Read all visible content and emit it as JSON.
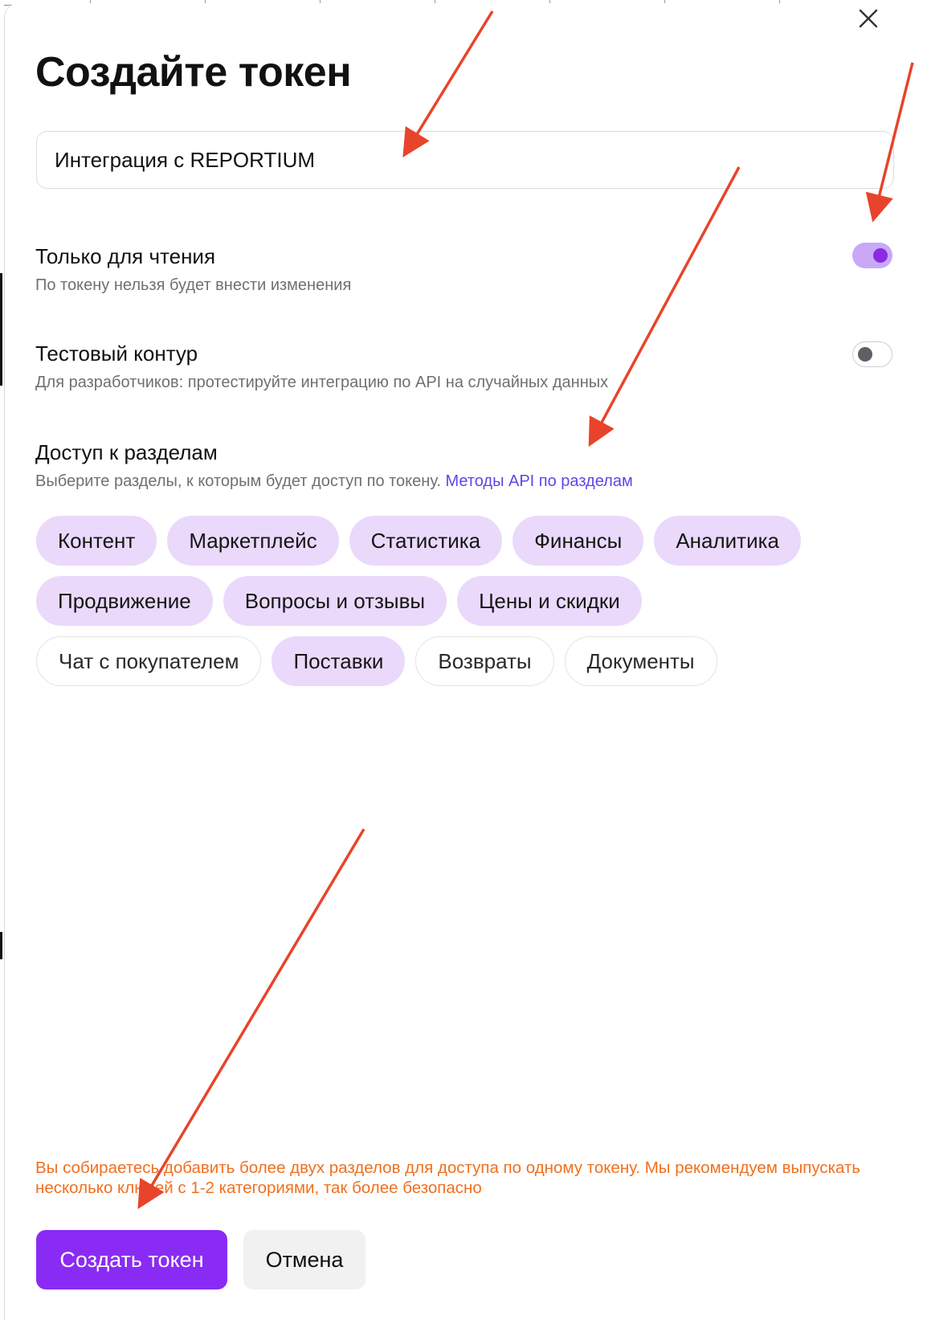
{
  "modal": {
    "title": "Создайте токен",
    "close_icon": "close-x-icon",
    "name_input": {
      "value": "Интеграция с REPORTIUM"
    }
  },
  "options": {
    "read_only": {
      "title": "Только для чтения",
      "description": "По токену нельзя будет внести изменения",
      "enabled": true
    },
    "test_contour": {
      "title": "Тестовый контур",
      "description": "Для разработчиков: протестируйте интеграцию по API на случайных данных",
      "enabled": false
    }
  },
  "access": {
    "title": "Доступ к разделам",
    "description": "Выберите разделы, к которым будет доступ по токену.",
    "link": "Методы API по разделам",
    "sections": [
      {
        "label": "Контент",
        "selected": true
      },
      {
        "label": "Маркетплейс",
        "selected": true
      },
      {
        "label": "Статистика",
        "selected": true
      },
      {
        "label": "Финансы",
        "selected": true
      },
      {
        "label": "Аналитика",
        "selected": true
      },
      {
        "label": "Продвижение",
        "selected": true
      },
      {
        "label": "Вопросы и отзывы",
        "selected": true
      },
      {
        "label": "Цены и скидки",
        "selected": true
      },
      {
        "label": "Чат с покупателем",
        "selected": false
      },
      {
        "label": "Поставки",
        "selected": true
      },
      {
        "label": "Возвраты",
        "selected": false
      },
      {
        "label": "Документы",
        "selected": false
      }
    ]
  },
  "warning": "Вы собираетесь добавить более двух разделов для доступа по одному токену. Мы рекомендуем выпускать несколько ключей с 1-2 категориями, так более безопасно",
  "buttons": {
    "create_label": "Создать токен",
    "cancel_label": "Отмена"
  },
  "colors": {
    "accent": "#8a2bf5",
    "chip_selected": "#ead9fb",
    "link": "#5b48e8",
    "warning": "#f0701f",
    "annotation_arrow": "#e8442b"
  }
}
